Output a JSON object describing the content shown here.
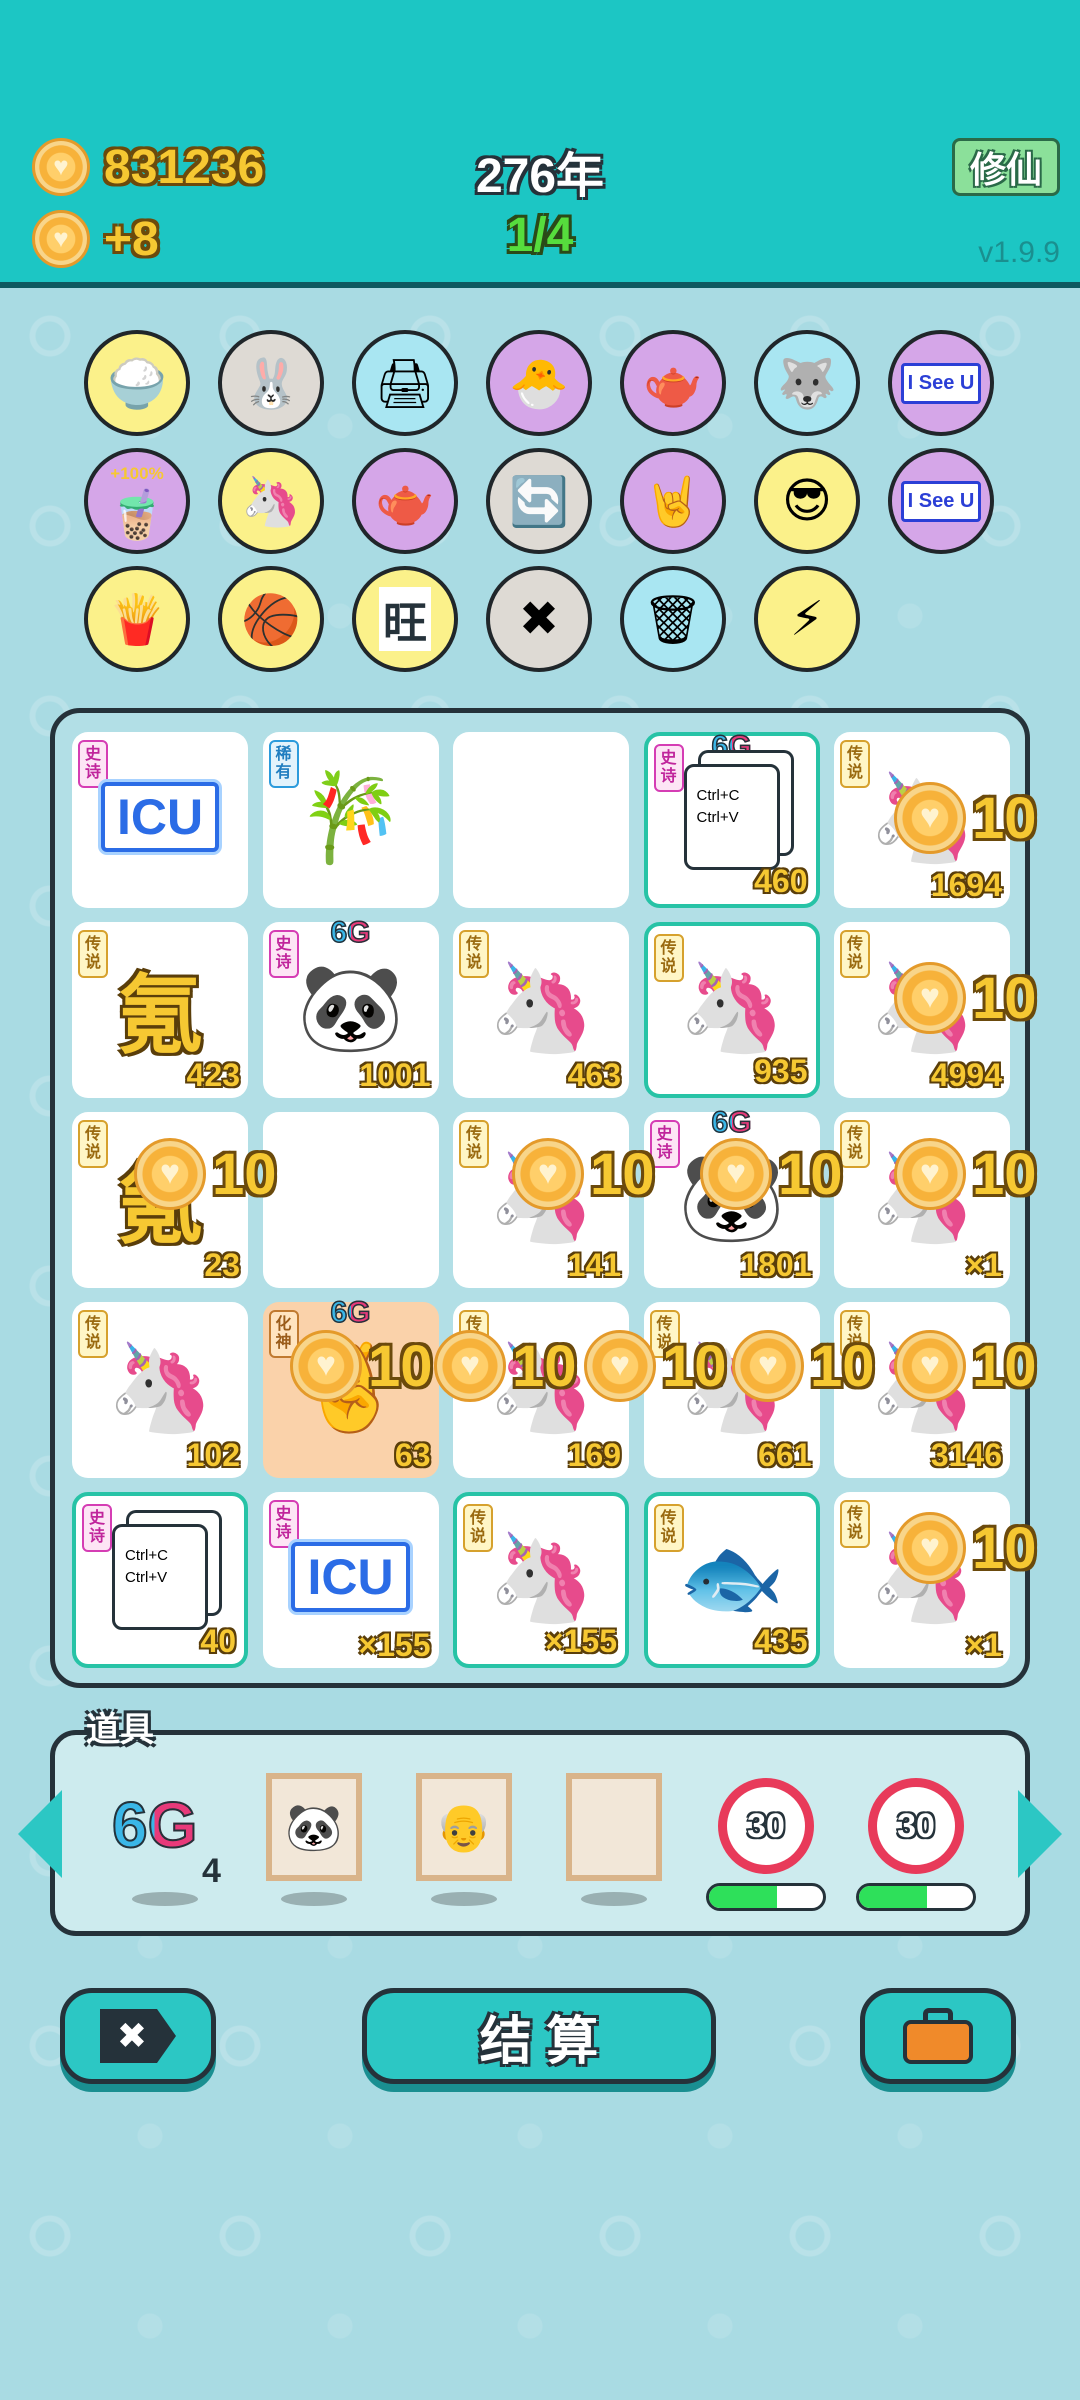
{
  "header": {
    "coins": "831236",
    "coin_rate": "+8",
    "year": "276年",
    "progress": "1/4",
    "cultivate_label": "修仙",
    "version": "v1.9.9"
  },
  "skills": [
    {
      "name": "rice-bowl-icon",
      "glyph": "🍚",
      "bg": "#fbf18a"
    },
    {
      "name": "rabbit-icon",
      "glyph": "🐰",
      "bg": "#dedad4"
    },
    {
      "name": "printer-icon",
      "glyph": "🖨",
      "bg": "#a9e6f2"
    },
    {
      "name": "egg-chick-icon",
      "glyph": "🐣",
      "bg": "#d5a6e8"
    },
    {
      "name": "gravy-boat-icon",
      "glyph": "🫖",
      "bg": "#d5a6e8"
    },
    {
      "name": "husky-icon",
      "glyph": "🐺",
      "bg": "#a9e6f2"
    },
    {
      "name": "i-see-u-icon",
      "text": "I See U",
      "bg": "#d5a6e8"
    },
    {
      "name": "bubble-tea-icon",
      "text": "+100%",
      "glyph": "🧋",
      "bg": "#d5a6e8"
    },
    {
      "name": "unicorn-icon",
      "glyph": "🦄",
      "bg": "#fbf18a"
    },
    {
      "name": "gravy-boat-icon",
      "glyph": "🫖",
      "bg": "#d5a6e8"
    },
    {
      "name": "refresh-icon",
      "glyph": "🔄",
      "bg": "#dedad4"
    },
    {
      "name": "rock-hand-icon",
      "glyph": "🤘",
      "bg": "#d5a6e8"
    },
    {
      "name": "sunglasses-cat-icon",
      "glyph": "😎",
      "bg": "#fbf18a"
    },
    {
      "name": "i-see-u-icon",
      "text": "I See U",
      "bg": "#d5a6e8"
    },
    {
      "name": "fries-icon",
      "glyph": "🍟",
      "bg": "#fbf18a"
    },
    {
      "name": "basketballs-icon",
      "glyph": "🏀",
      "bg": "#fbf18a"
    },
    {
      "name": "wang-tiles-icon",
      "text": "旺",
      "bg": "#fbf18a"
    },
    {
      "name": "delete-icon",
      "glyph": "✖",
      "bg": "#dedad4"
    },
    {
      "name": "trash-bag-icon",
      "glyph": "🗑",
      "bg": "#a9e6f2"
    },
    {
      "name": "lightning-icon",
      "glyph": "⚡",
      "bg": "#fbf18a"
    }
  ],
  "board": {
    "rows": [
      [
        {
          "tag": "史诗",
          "kind": "epic",
          "art": "icu",
          "label": "ICU",
          "count": ""
        },
        {
          "tag": "稀有",
          "kind": "rare",
          "art": "bamboo",
          "glyph": "🎋",
          "count": ""
        },
        {
          "tag": "",
          "kind": "",
          "art": "empty",
          "count": ""
        },
        {
          "tag": "史诗",
          "kind": "epic",
          "art": "ctrl",
          "label": "Ctrl+C\nCtrl+V",
          "g6": "6G",
          "count": "460",
          "hl": true
        },
        {
          "tag": "传说",
          "kind": "leg",
          "art": "glyph",
          "glyph": "🦄",
          "count": "1694"
        }
      ],
      [
        {
          "tag": "传说",
          "kind": "leg",
          "art": "qi",
          "label": "氪",
          "count": "423"
        },
        {
          "tag": "史诗",
          "kind": "epic",
          "art": "glyph",
          "glyph": "🐼",
          "g6": "6G",
          "count": "1001"
        },
        {
          "tag": "传说",
          "kind": "leg",
          "art": "glyph",
          "glyph": "🦄",
          "count": "463"
        },
        {
          "tag": "传说",
          "kind": "leg",
          "art": "glyph",
          "glyph": "🦄",
          "count": "935",
          "hl": true
        },
        {
          "tag": "传说",
          "kind": "leg",
          "art": "glyph",
          "glyph": "🦄",
          "count": "4994"
        }
      ],
      [
        {
          "tag": "传说",
          "kind": "leg",
          "art": "qi",
          "label": "氪",
          "count": "23"
        },
        {
          "tag": "",
          "kind": "",
          "art": "empty",
          "count": ""
        },
        {
          "tag": "传说",
          "kind": "leg",
          "art": "glyph",
          "glyph": "🦄",
          "count": "141"
        },
        {
          "tag": "史诗",
          "kind": "epic",
          "art": "glyph",
          "glyph": "🐼",
          "g6": "6G",
          "count": "1801"
        },
        {
          "tag": "传说",
          "kind": "leg",
          "art": "glyph",
          "glyph": "🦄",
          "count": "×1"
        }
      ],
      [
        {
          "tag": "传说",
          "kind": "leg",
          "art": "glyph",
          "glyph": "🦄",
          "count": "102"
        },
        {
          "tag": "化神",
          "kind": "hua",
          "art": "glyph",
          "glyph": "🤞",
          "g6": "6G",
          "count": "63",
          "orange": true
        },
        {
          "tag": "传说",
          "kind": "leg",
          "art": "glyph",
          "glyph": "🦄",
          "count": "169"
        },
        {
          "tag": "传说",
          "kind": "leg",
          "art": "glyph",
          "glyph": "🦄",
          "count": "661"
        },
        {
          "tag": "传说",
          "kind": "leg",
          "art": "glyph",
          "glyph": "🦄",
          "count": "3146"
        }
      ],
      [
        {
          "tag": "史诗",
          "kind": "epic",
          "art": "ctrl",
          "label": "Ctrl+C\nCtrl+V",
          "count": "40",
          "hl": true
        },
        {
          "tag": "史诗",
          "kind": "epic",
          "art": "icu",
          "label": "ICU",
          "count": "×155"
        },
        {
          "tag": "传说",
          "kind": "leg",
          "art": "glyph",
          "glyph": "🦄",
          "count": "×155",
          "hl": true
        },
        {
          "tag": "传说",
          "kind": "leg",
          "art": "glyph",
          "glyph": "🐟",
          "count": "435",
          "hl": true
        },
        {
          "tag": "传说",
          "kind": "leg",
          "art": "glyph",
          "glyph": "🦄",
          "count": "×1"
        }
      ]
    ],
    "coin_popup_value": "10"
  },
  "items": {
    "title": "道具",
    "g6_label": "6G",
    "g6_count": "4",
    "frames": [
      "🐼",
      "👴",
      ""
    ],
    "timers": [
      {
        "value": "30",
        "progress": 0.6
      },
      {
        "value": "30",
        "progress": 0.6
      }
    ]
  },
  "buttons": {
    "settle_label": "结 算"
  },
  "colors": {
    "header": "#1cc6c4",
    "background": "#a9dbe3",
    "accent": "#2cc7c4",
    "outline": "#25323a"
  }
}
